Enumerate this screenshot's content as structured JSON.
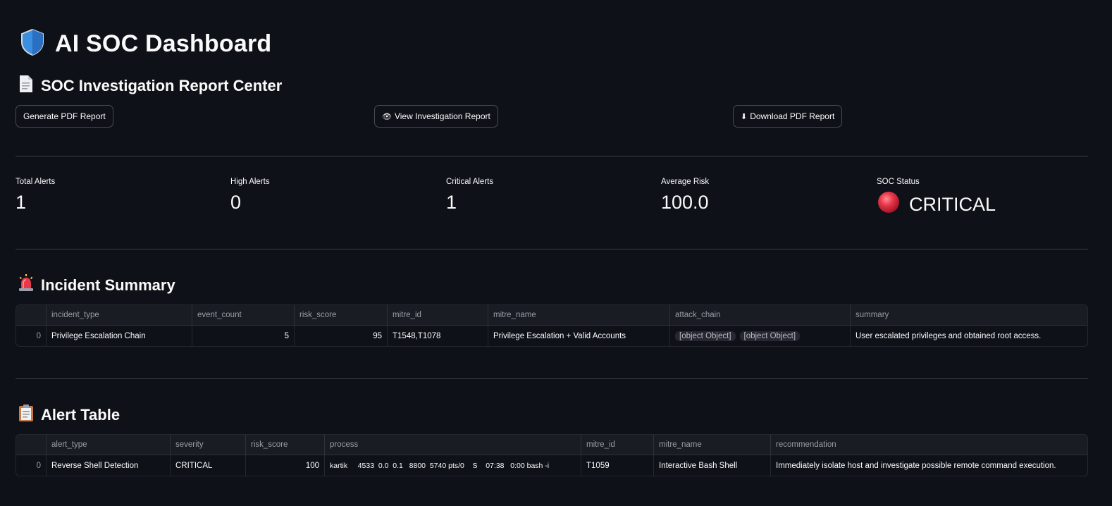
{
  "header": {
    "title": "AI SOC Dashboard",
    "icon": "shield-icon"
  },
  "report_center": {
    "title": "SOC Investigation Report Center",
    "icon": "document-icon",
    "generate_label": "Generate PDF Report",
    "view_label": "View Investigation Report",
    "download_label": "Download PDF Report"
  },
  "metrics": {
    "total_alerts": {
      "label": "Total Alerts",
      "value": "1"
    },
    "high_alerts": {
      "label": "High Alerts",
      "value": "0"
    },
    "critical_alerts": {
      "label": "Critical Alerts",
      "value": "1"
    },
    "average_risk": {
      "label": "Average Risk",
      "value": "100.0"
    },
    "soc_status": {
      "label": "SOC Status",
      "value": "CRITICAL",
      "color": "#e8394b"
    }
  },
  "incident_summary": {
    "title": "Incident Summary",
    "icon": "siren-icon",
    "columns": [
      "incident_type",
      "event_count",
      "risk_score",
      "mitre_id",
      "mitre_name",
      "attack_chain",
      "summary"
    ],
    "rows": [
      {
        "index": "0",
        "incident_type": "Privilege Escalation Chain",
        "event_count": "5",
        "risk_score": "95",
        "mitre_id": "T1548,T1078",
        "mitre_name": "Privilege Escalation + Valid Accounts",
        "attack_chain": [
          "[object Object]",
          "[object Object]"
        ],
        "summary": "User escalated privileges and obtained root access."
      }
    ]
  },
  "alert_table": {
    "title": "Alert Table",
    "icon": "clipboard-icon",
    "columns": [
      "alert_type",
      "severity",
      "risk_score",
      "process",
      "mitre_id",
      "mitre_name",
      "recommendation"
    ],
    "rows": [
      {
        "index": "0",
        "alert_type": "Reverse Shell Detection",
        "severity": "CRITICAL",
        "risk_score": "100",
        "process": "kartik     4533  0.0  0.1   8800  5740 pts/0    S    07:38   0:00 bash -i",
        "mitre_id": "T1059",
        "mitre_name": "Interactive Bash Shell",
        "recommendation": "Immediately isolate host and investigate possible remote command execution."
      }
    ]
  }
}
